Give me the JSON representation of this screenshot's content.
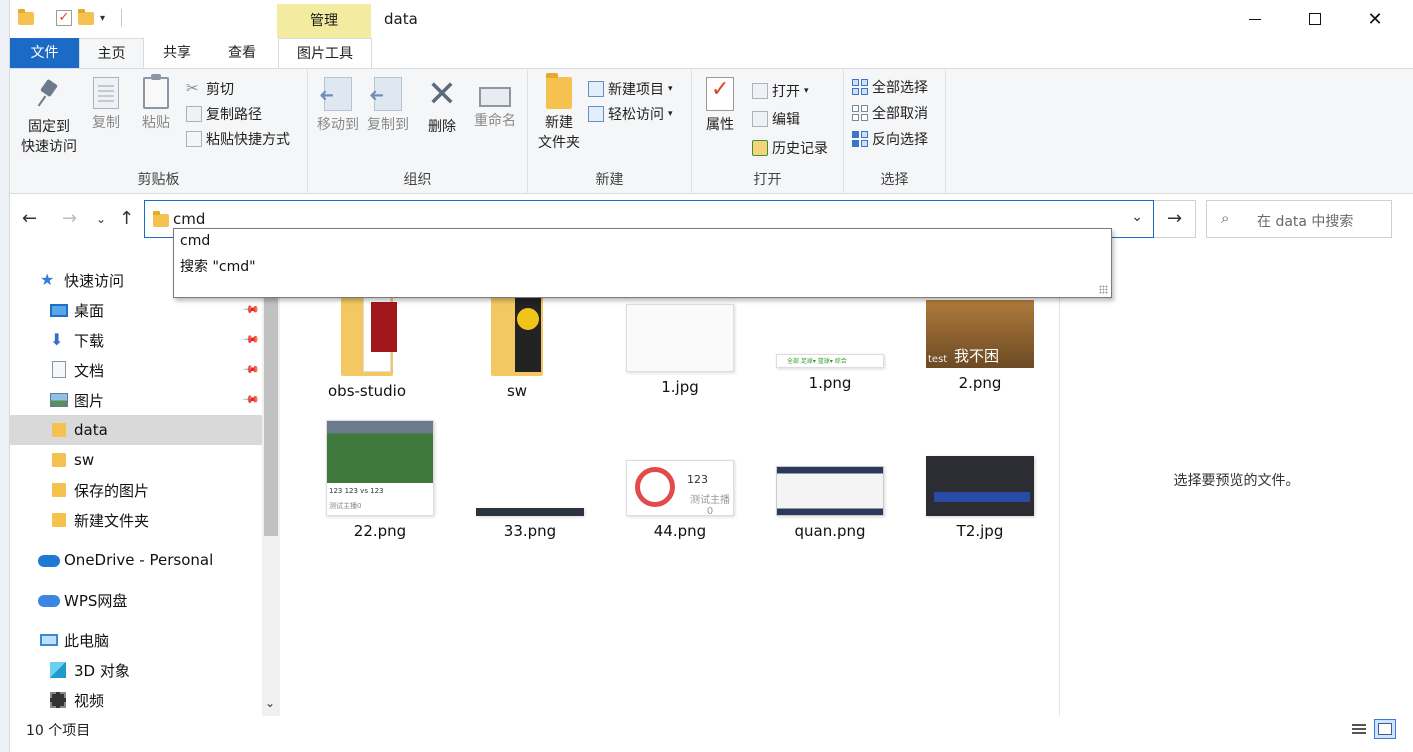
{
  "window": {
    "title": "data",
    "context_tab": "管理",
    "controls": {
      "minimize": "—",
      "maximize": "☐",
      "close": "✕"
    }
  },
  "quick_access_toolbar": {
    "dropdown_glyph": "▾"
  },
  "ribbon_tabs": {
    "file": "文件",
    "home": "主页",
    "share": "共享",
    "view": "查看",
    "picture_tools": "图片工具",
    "collapse_glyph": "︿",
    "help_glyph": "?"
  },
  "ribbon": {
    "clipboard": {
      "label": "剪贴板",
      "pin": "固定到\n快速访问",
      "copy": "复制",
      "paste": "粘贴",
      "cut": "剪切",
      "copy_path": "复制路径",
      "paste_shortcut": "粘贴快捷方式"
    },
    "organize": {
      "label": "组织",
      "move_to": "移动到",
      "copy_to": "复制到",
      "delete": "删除",
      "rename": "重命名"
    },
    "new": {
      "label": "新建",
      "new_folder": "新建\n文件夹",
      "new_item": "新建项目",
      "easy_access": "轻松访问"
    },
    "open": {
      "label": "打开",
      "properties": "属性",
      "open": "打开",
      "edit": "编辑",
      "history": "历史记录"
    },
    "select": {
      "label": "选择",
      "select_all": "全部选择",
      "select_none": "全部取消",
      "invert": "反向选择"
    }
  },
  "address_bar": {
    "value": "cmd",
    "search_placeholder": "在 data 中搜索",
    "nav": {
      "back": "←",
      "forward": "→",
      "recent": "⌄",
      "up": "↑",
      "go": "→",
      "dropdown": "⌄",
      "search_glyph": "⌕"
    }
  },
  "autocomplete": {
    "options": [
      "cmd",
      "搜索 \"cmd\""
    ]
  },
  "nav_pane": {
    "items": [
      {
        "label": "快速访问"
      },
      {
        "label": "桌面"
      },
      {
        "label": "下载"
      },
      {
        "label": "文档"
      },
      {
        "label": "图片"
      },
      {
        "label": "data"
      },
      {
        "label": "sw"
      },
      {
        "label": "保存的图片"
      },
      {
        "label": "新建文件夹"
      },
      {
        "label": "OneDrive - Personal"
      },
      {
        "label": "WPS网盘"
      },
      {
        "label": "此电脑"
      },
      {
        "label": "3D 对象"
      },
      {
        "label": "视频"
      }
    ],
    "pin_glyph": "📌"
  },
  "files": [
    {
      "name": "obs-studio"
    },
    {
      "name": "sw"
    },
    {
      "name": "1.jpg"
    },
    {
      "name": "1.png"
    },
    {
      "name": "2.png",
      "caption": "我不困",
      "corner": "test"
    },
    {
      "name": "22.png",
      "line1": "123 123 vs 123",
      "line2": "测试主播0"
    },
    {
      "name": "33.png"
    },
    {
      "name": "44.png",
      "number": "123",
      "subtitle": "测试主播0"
    },
    {
      "name": "quan.png"
    },
    {
      "name": "T2.jpg"
    }
  ],
  "preview_pane": {
    "message": "选择要预览的文件。"
  },
  "status_bar": {
    "count": "10 个项目"
  },
  "colors": {
    "accent": "#1a6ac6",
    "manage_tab": "#f3eb9f",
    "ribbon_bg": "#f5f6f7",
    "folder": "#f6c24f"
  }
}
